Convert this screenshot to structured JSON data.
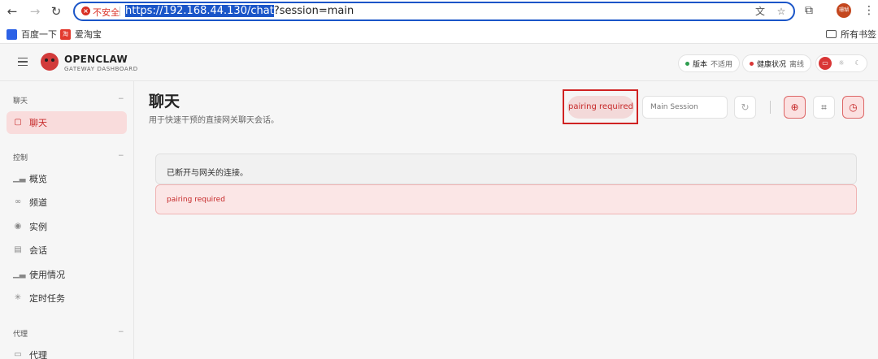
{
  "browser": {
    "insecure_label": "不安全",
    "url_selected": "https://192.168.44.130/chat",
    "url_rest": "?session=main",
    "profile_label": "珊瑚",
    "bookmarks": [
      {
        "label": "百度一下"
      },
      {
        "label": "爱淘宝"
      }
    ],
    "all_bookmarks": "所有书签"
  },
  "app": {
    "brand": "OPENCLAW",
    "brand_sub": "GATEWAY DASHBOARD",
    "version_key": "版本",
    "version_value": "不适用",
    "health_key": "健康状况",
    "health_value": "离线",
    "colors": {
      "accent": "#d93636",
      "ok": "#2e9e4f",
      "error": "#c62828"
    }
  },
  "sidebar": {
    "sections": [
      {
        "title": "聊天",
        "items": [
          {
            "label": "聊天",
            "icon": "chat-icon"
          }
        ]
      },
      {
        "title": "控制",
        "items": [
          {
            "label": "概览",
            "icon": "bar-chart-icon"
          },
          {
            "label": "频道",
            "icon": "link-icon"
          },
          {
            "label": "实例",
            "icon": "radio-icon"
          },
          {
            "label": "会话",
            "icon": "document-icon"
          },
          {
            "label": "使用情况",
            "icon": "bar-chart-icon"
          },
          {
            "label": "定时任务",
            "icon": "loader-icon"
          }
        ]
      },
      {
        "title": "代理",
        "items": [
          {
            "label": "代理",
            "icon": "folder-icon"
          }
        ]
      }
    ]
  },
  "main": {
    "title": "聊天",
    "subtitle": "用于快速干预的直接网关聊天会话。",
    "pairing_status": "pairing required",
    "session_placeholder": "Main Session",
    "disconnect_message": "已断开与网关的连接。",
    "error_message": "pairing required"
  }
}
